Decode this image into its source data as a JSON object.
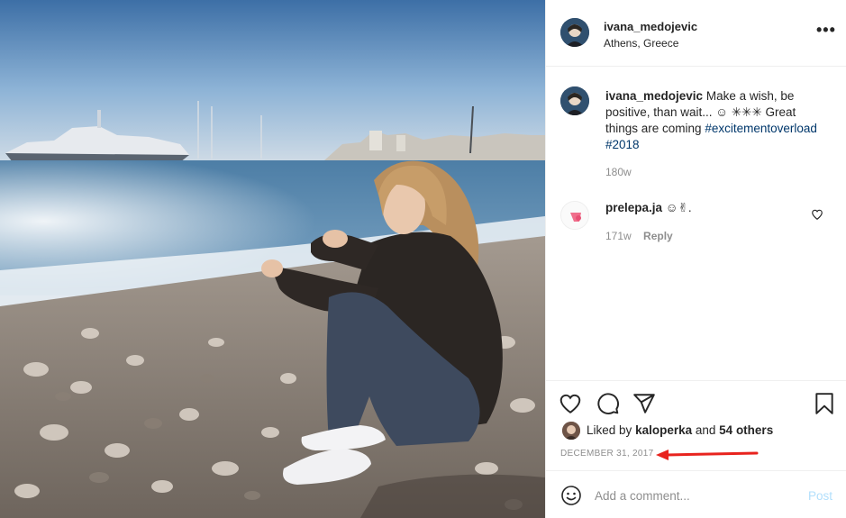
{
  "post": {
    "author": "ivana_medojevic",
    "location": "Athens, Greece",
    "caption": {
      "username": "ivana_medojevic",
      "text": "Make a wish, be positive, than wait... ☺ ✳︎✳︎✳︎ Great things are coming",
      "hashtags": [
        "#excitementoverload",
        "#2018"
      ],
      "time": "180w"
    },
    "comments": [
      {
        "username": "prelepa.ja",
        "text": "☺✌︎.",
        "time": "171w",
        "reply_label": "Reply"
      }
    ],
    "likes": {
      "prefix": "Liked by",
      "user": "kaloperka",
      "connector": "and",
      "others": "54 others"
    },
    "date": "DECEMBER 31, 2017",
    "add_comment": {
      "placeholder": "Add a comment...",
      "post_label": "Post"
    }
  },
  "icons": {
    "more": "more-options-icon",
    "like": "heart-icon",
    "comment": "comment-icon",
    "share": "share-icon",
    "save": "bookmark-icon",
    "emoji": "emoji-icon",
    "annotation": "red-arrow-icon"
  },
  "colors": {
    "text": "#262626",
    "secondary": "#8e8e8e",
    "hashtag": "#00376b",
    "post_disabled": "#b2dffc",
    "annotation": "#e8231e"
  }
}
